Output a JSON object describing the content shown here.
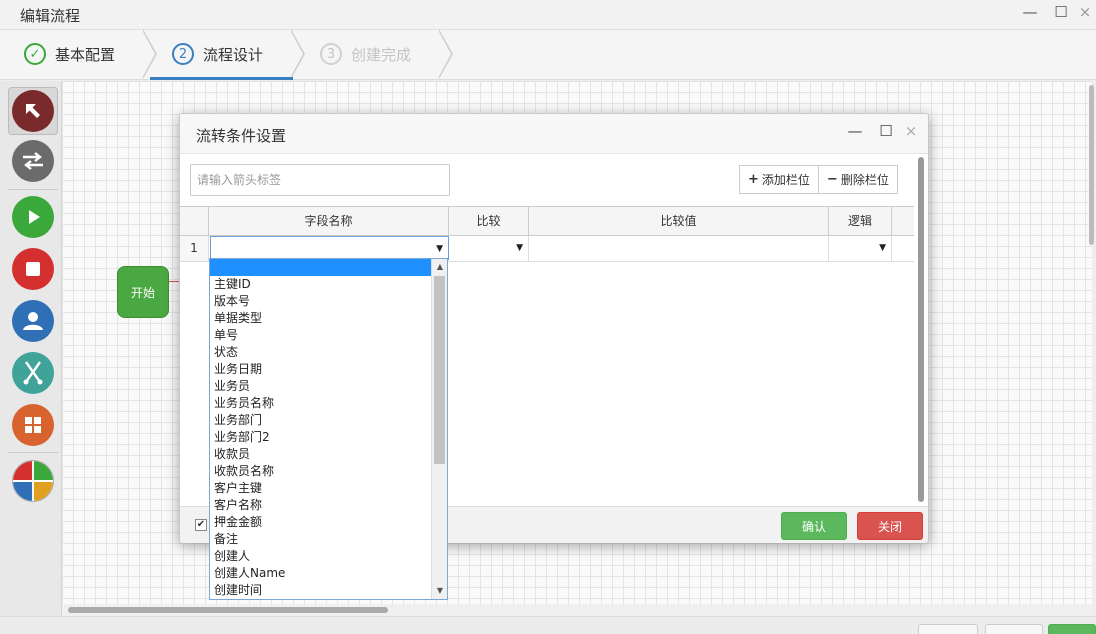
{
  "window": {
    "title": "编辑流程",
    "minimize": "—",
    "maximize": "☐",
    "close": "×"
  },
  "steps": [
    {
      "number": "✓",
      "label": "基本配置",
      "state": "done"
    },
    {
      "number": "2",
      "label": "流程设计",
      "state": "active"
    },
    {
      "number": "3",
      "label": "创建完成",
      "state": "pending"
    }
  ],
  "canvas": {
    "start_node_label": "开始"
  },
  "toolbar": [
    {
      "icon": "pointer-icon",
      "color": "#7a2a2a"
    },
    {
      "icon": "transition-icon",
      "color": "#6b6b6b"
    },
    {
      "icon": "start-icon",
      "color": "#3aa83a"
    },
    {
      "icon": "end-icon",
      "color": "#d43030"
    },
    {
      "icon": "user-task-icon",
      "color": "#2e6fb5"
    },
    {
      "icon": "fork-icon",
      "color": "#3fa39a"
    },
    {
      "icon": "subprocess-icon",
      "color": "#d8632e"
    },
    {
      "icon": "gateway-icon",
      "color": "#e0a020"
    }
  ],
  "dialog": {
    "title": "流转条件设置",
    "minimize": "—",
    "maximize": "☐",
    "close": "×",
    "arrow_label_placeholder": "请输入箭头标签",
    "add_column": "添加栏位",
    "remove_column": "删除栏位",
    "columns": [
      "字段名称",
      "比较",
      "比较值",
      "逻辑"
    ],
    "rows": [
      {
        "index": "1",
        "field": "",
        "compare": "",
        "value": "",
        "logic": ""
      }
    ],
    "confirm": "确认",
    "cancel": "关闭",
    "checkbox_checked": true
  },
  "dropdown_options": [
    "",
    "主键ID",
    "版本号",
    "单据类型",
    "单号",
    "状态",
    "业务日期",
    "业务员",
    "业务员名称",
    "业务部门",
    "业务部门2",
    "收款员",
    "收款员名称",
    "客户主键",
    "客户名称",
    "押金金额",
    "备注",
    "创建人",
    "创建人Name",
    "创建时间"
  ],
  "colors": {
    "accent": "#3a7fc1",
    "success": "#5cb85c",
    "danger": "#d9534f",
    "selection": "#1e90ff"
  }
}
